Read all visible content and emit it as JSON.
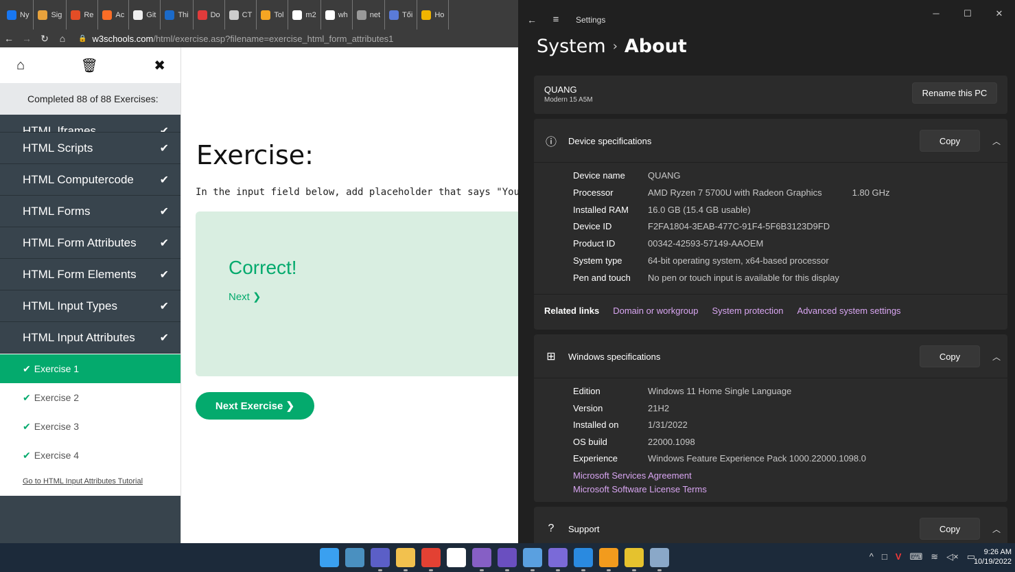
{
  "browser": {
    "tabs": [
      {
        "label": "Ny",
        "color": "#1877f2"
      },
      {
        "label": "Sig",
        "color": "#e8a23c"
      },
      {
        "label": "Re",
        "color": "#e44d26"
      },
      {
        "label": "Ac",
        "color": "#fc6d26"
      },
      {
        "label": "Git",
        "color": "#eeeeee"
      },
      {
        "label": "Thi",
        "color": "#1b6ac9"
      },
      {
        "label": "Do",
        "color": "#e03b3b"
      },
      {
        "label": "CT",
        "color": "#cccccc"
      },
      {
        "label": "Tol",
        "color": "#f5a623"
      },
      {
        "label": "m2",
        "color": "#ffffff"
      },
      {
        "label": "wh",
        "color": "#ffffff"
      },
      {
        "label": "net",
        "color": "#999999"
      },
      {
        "label": "Tối",
        "color": "#5a7bd8"
      },
      {
        "label": "Ho",
        "color": "#f0b400"
      }
    ],
    "url_host": "w3schools.com",
    "url_path": "/html/exercise.asp?filename=exercise_html_form_attributes1"
  },
  "sidebar": {
    "completed": "Completed 88 of 88 Exercises:",
    "partial_item": "HTML Iframes",
    "items": [
      {
        "label": "HTML Scripts"
      },
      {
        "label": "HTML Computercode"
      },
      {
        "label": "HTML Forms"
      },
      {
        "label": "HTML Form Attributes"
      },
      {
        "label": "HTML Form Elements"
      },
      {
        "label": "HTML Input Types"
      },
      {
        "label": "HTML Input Attributes"
      }
    ],
    "check_glyph": "✔",
    "exercises": [
      {
        "label": "Exercise 1"
      },
      {
        "label": "Exercise 2"
      },
      {
        "label": "Exercise 3"
      },
      {
        "label": "Exercise 4"
      }
    ],
    "tutorial_link": "Go to HTML Input Attributes Tutorial"
  },
  "main": {
    "title": "Exercise:",
    "instruction": "In the input field below, add placeholder that says \"Your name h",
    "correct": "Correct!",
    "next": "Next ❯",
    "next_exercise": "Next Exercise ❯"
  },
  "settings": {
    "app_title": "Settings",
    "breadcrumb_parent": "System",
    "breadcrumb_current": "About",
    "pc_name": "QUANG",
    "pc_model": "Modern 15 A5M",
    "rename_button": "Rename this PC",
    "copy_label": "Copy",
    "device_specs_title": "Device specifications",
    "device_specs": [
      {
        "k": "Device name",
        "v": "QUANG",
        "x": ""
      },
      {
        "k": "Processor",
        "v": "AMD Ryzen 7 5700U with Radeon Graphics",
        "x": "1.80 GHz"
      },
      {
        "k": "Installed RAM",
        "v": "16.0 GB (15.4 GB usable)",
        "x": ""
      },
      {
        "k": "Device ID",
        "v": "F2FA1804-3EAB-477C-91F4-5F6B3123D9FD",
        "x": ""
      },
      {
        "k": "Product ID",
        "v": "00342-42593-57149-AAOEM",
        "x": ""
      },
      {
        "k": "System type",
        "v": "64-bit operating system, x64-based processor",
        "x": ""
      },
      {
        "k": "Pen and touch",
        "v": "No pen or touch input is available for this display",
        "x": ""
      }
    ],
    "related_label": "Related links",
    "related_links": [
      "Domain or workgroup",
      "System protection",
      "Advanced system settings"
    ],
    "windows_specs_title": "Windows specifications",
    "windows_specs": [
      {
        "k": "Edition",
        "v": "Windows 11 Home Single Language"
      },
      {
        "k": "Version",
        "v": "21H2"
      },
      {
        "k": "Installed on",
        "v": "1/31/2022"
      },
      {
        "k": "OS build",
        "v": "22000.1098"
      },
      {
        "k": "Experience",
        "v": "Windows Feature Experience Pack 1000.22000.1098.0"
      }
    ],
    "ms_links": [
      "Microsoft Services Agreement",
      "Microsoft Software License Terms"
    ],
    "support_title": "Support"
  },
  "taskbar": {
    "time": "9:26 AM",
    "date": "10/19/2022",
    "apps": [
      {
        "name": "start-icon",
        "color": "#3aa0f0"
      },
      {
        "name": "search-icon",
        "color": "#4a90c0"
      },
      {
        "name": "teams-icon",
        "color": "#5b5fc7"
      },
      {
        "name": "file-explorer-icon",
        "color": "#f2c14e"
      },
      {
        "name": "chrome-icon",
        "color": "#e34133"
      },
      {
        "name": "notion-icon",
        "color": "#ffffff"
      },
      {
        "name": "visual-studio-icon",
        "color": "#865fc5"
      },
      {
        "name": "vs-purple-icon",
        "color": "#6a4fc0"
      },
      {
        "name": "photos-icon",
        "color": "#5aa0e0"
      },
      {
        "name": "chip-app-icon",
        "color": "#7a6ad8"
      },
      {
        "name": "vscode-icon",
        "color": "#2a8ae0"
      },
      {
        "name": "orange-app-icon",
        "color": "#f29b1d"
      },
      {
        "name": "figma-like-icon",
        "color": "#e5c22e"
      },
      {
        "name": "settings-gear-icon",
        "color": "#8aa8c8"
      }
    ]
  }
}
